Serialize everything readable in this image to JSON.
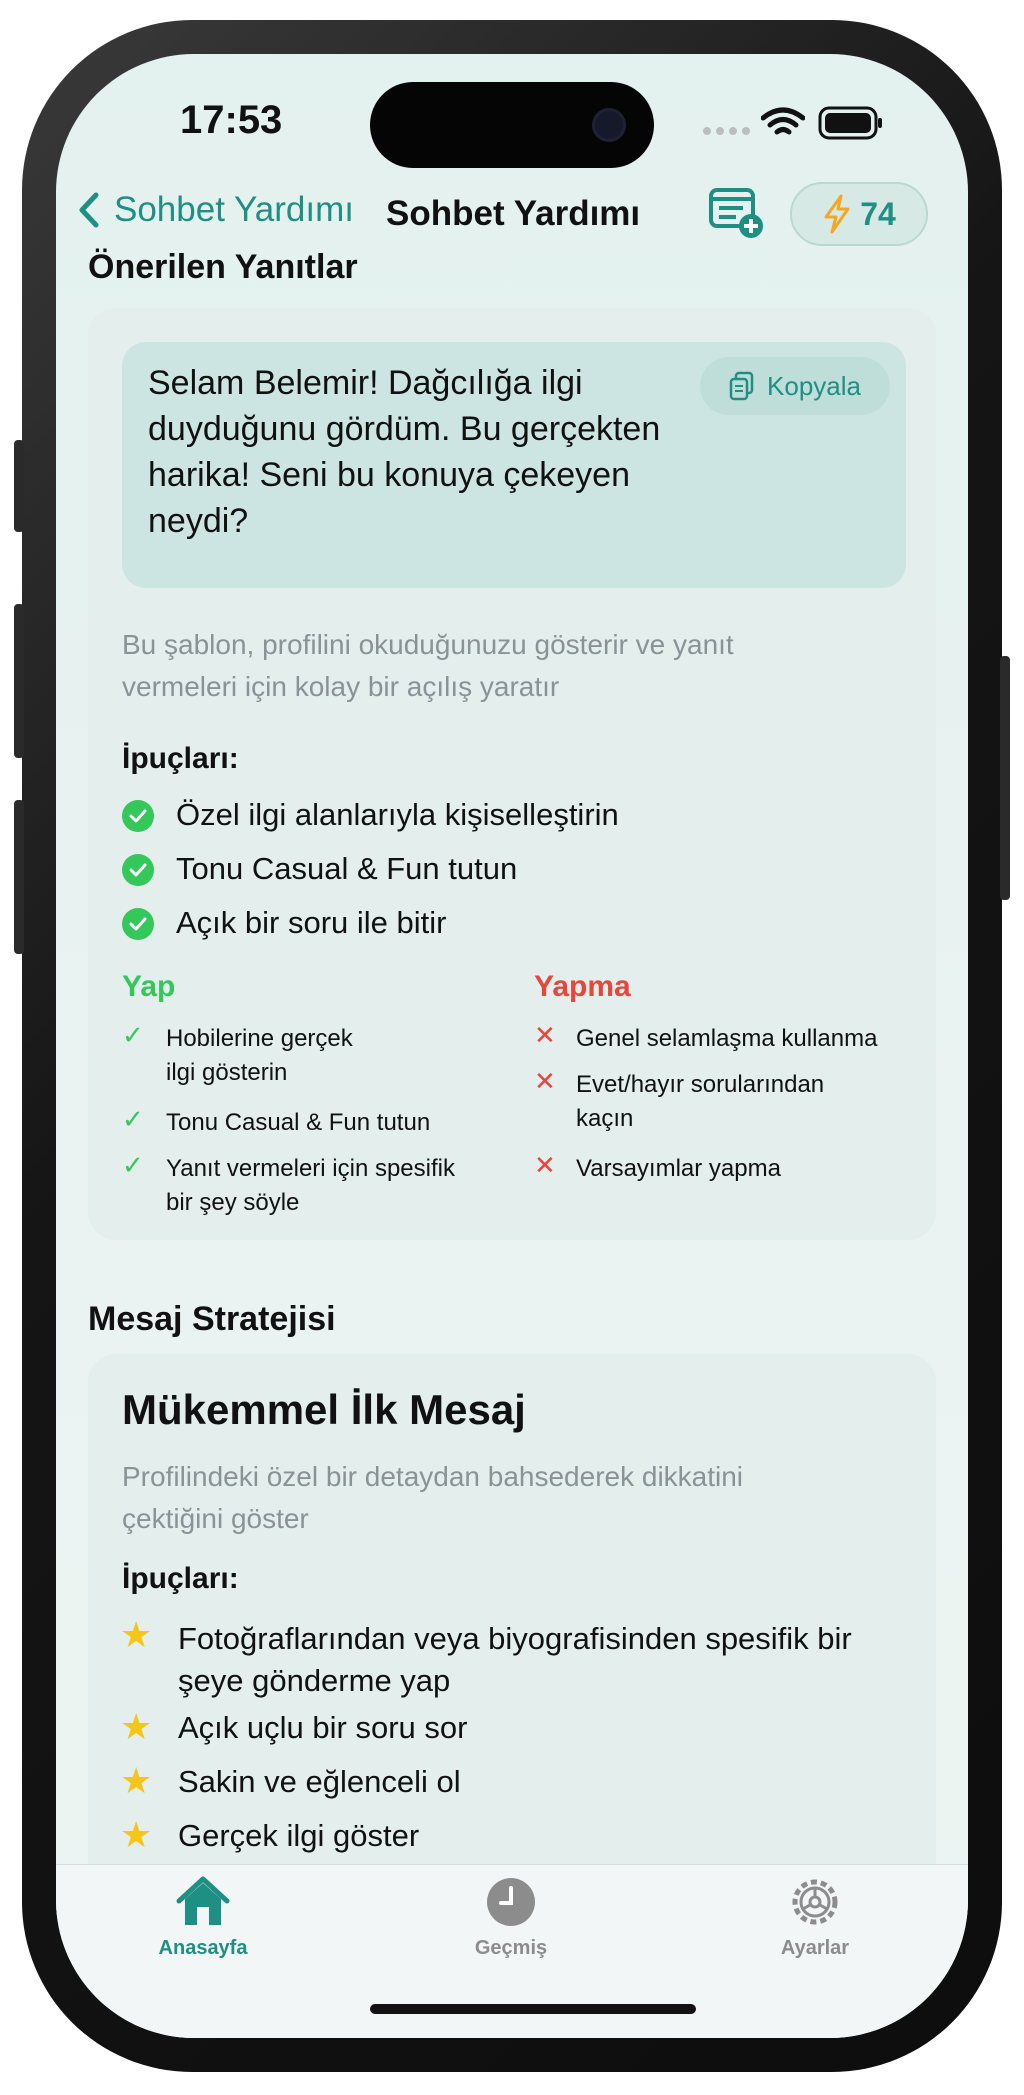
{
  "status": {
    "time": "17:53"
  },
  "nav": {
    "back_label": "Sohbet Yardımı",
    "title": "Sohbet Yardımı",
    "credits": "74"
  },
  "suggested": {
    "heading": "Önerilen Yanıtlar",
    "message_lines": [
      "Selam Belemir! Dağcılığa ilgi",
      "duyduğunu gördüm. Bu gerçekten",
      "harika! Seni bu konuya çekeyen",
      "neydi?"
    ],
    "copy_label": "Kopyala",
    "description_lines": [
      "Bu şablon, profilini okuduğunuzu gösterir ve yanıt",
      "vermeleri için kolay bir açılış yaratır"
    ],
    "tips_title": "İpuçları:",
    "tips": [
      "Özel ilgi alanlarıyla kişiselleştirin",
      "Tonu Casual & Fun tutun",
      "Açık bir soru ile bitir"
    ],
    "do_title": "Yap",
    "do_items": [
      [
        "Hobilerine gerçek",
        "ilgi gösterin"
      ],
      [
        "Tonu Casual & Fun tutun"
      ],
      [
        "Yanıt vermeleri için spesifik",
        "bir şey söyle"
      ]
    ],
    "dont_title": "Yapma",
    "dont_items": [
      [
        "Genel selamlaşma kullanma"
      ],
      [
        "Evet/hayır sorularından",
        "kaçın"
      ],
      [
        "Varsayımlar yapma"
      ]
    ]
  },
  "strategy": {
    "heading": "Mesaj Stratejisi",
    "card_title": "Mükemmel İlk Mesaj",
    "description_lines": [
      "Profilindeki özel bir detaydan bahsederek dikkatini",
      "çektiğini göster"
    ],
    "tips_title": "İpuçları:",
    "tips": [
      [
        "Fotoğraflarından veya biyografisinden spesifik bir",
        "şeye gönderme yap"
      ],
      [
        "Açık uçlu bir soru sor"
      ],
      [
        "Sakin ve eğlenceli ol"
      ],
      [
        "Gerçek ilgi göster"
      ]
    ]
  },
  "tabbar": {
    "items": [
      "Anasayfa",
      "Geçmiş",
      "Ayarlar"
    ],
    "active": "Anasayfa"
  },
  "colors": {
    "accent": "#1f8f83",
    "do": "#34c759",
    "dont": "#e5473d",
    "star": "#f5c518"
  }
}
